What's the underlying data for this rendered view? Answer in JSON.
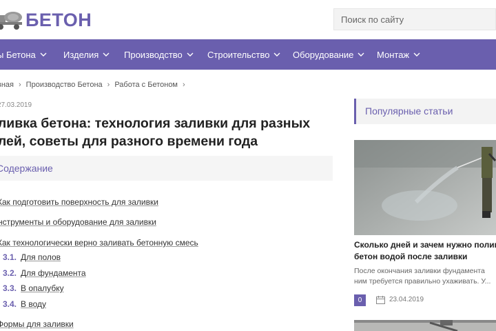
{
  "brand": {
    "name": "БЕТОН",
    "accent": "#6a5fae"
  },
  "search": {
    "placeholder": "Поиск по сайту"
  },
  "nav": {
    "items": [
      {
        "label": "ы Бетона"
      },
      {
        "label": "Изделия"
      },
      {
        "label": "Производство"
      },
      {
        "label": "Строительство"
      },
      {
        "label": "Оборудование"
      },
      {
        "label": "Монтаж"
      }
    ]
  },
  "breadcrumb": {
    "items": [
      "вная",
      "Производство Бетона",
      "Работа с Бетоном"
    ]
  },
  "article": {
    "date": "27.03.2019",
    "title_line1": "аливка бетона: технология заливки для разных",
    "title_line2": "елей, советы для разного времени года"
  },
  "toc": {
    "title": "Содержание",
    "items": [
      {
        "label": "Как подготовить поверхность для заливки"
      },
      {
        "label": "нструменты и оборудование для заливки"
      },
      {
        "label": "Как технологически верно заливать бетонную смесь"
      },
      {
        "label": "Формы для заливки"
      }
    ],
    "subitems": [
      {
        "num": "3.1.",
        "label": "Для полов"
      },
      {
        "num": "3.2.",
        "label": "Для фундамента"
      },
      {
        "num": "3.3.",
        "label": "В опалубку"
      },
      {
        "num": "3.4.",
        "label": "В воду"
      }
    ]
  },
  "sidebar": {
    "heading": "Популярные статьи",
    "article": {
      "title_line1": "Сколько дней и зачем нужно полив",
      "title_line2": "бетон водой после заливки",
      "excerpt_line1": "После окончания заливки фундамента",
      "excerpt_line2": "ним требуется правильно ухаживать. У...",
      "badge": "0",
      "date": "23.04.2019"
    }
  }
}
